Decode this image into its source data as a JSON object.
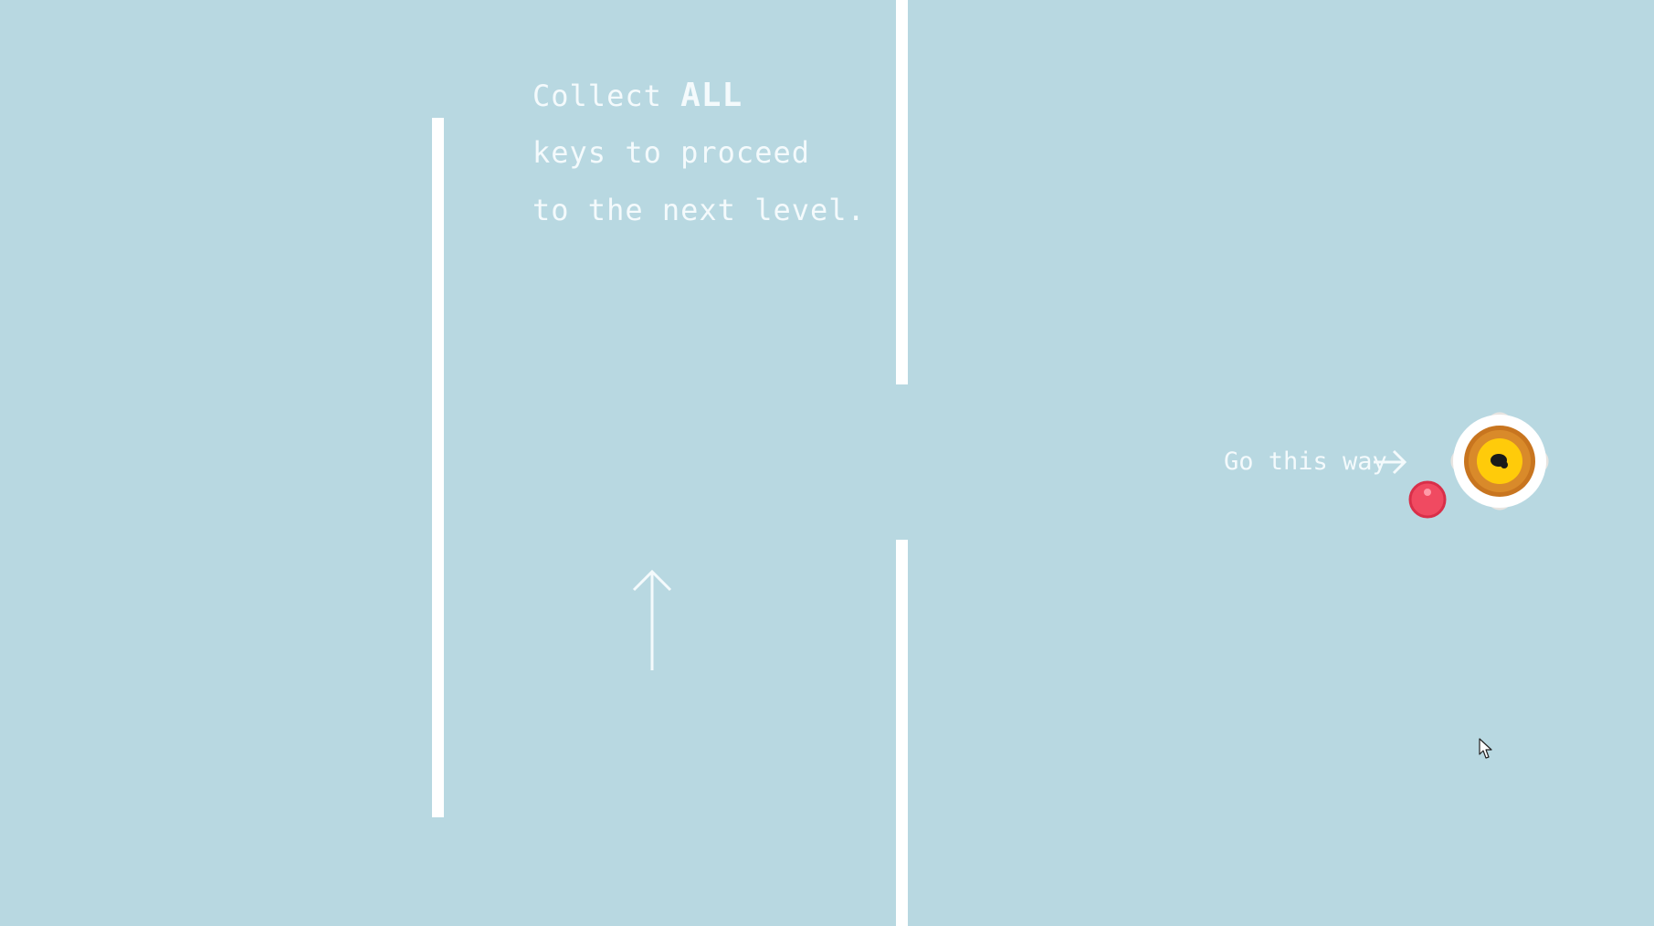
{
  "instructions": {
    "line1_prefix": "Collect ",
    "line1_emphasis": "ALL",
    "line2": "keys to proceed",
    "line3": "to the next level."
  },
  "direction_hint": {
    "label": "Go this way",
    "arrow_icon": "right-arrow-icon"
  },
  "icons": {
    "up_arrow": "up-arrow-icon",
    "key_goal": "key-orb-icon",
    "player": "player-ball",
    "cursor": "mouse-pointer-icon"
  },
  "colors": {
    "background": "#b8d8e1",
    "wall": "#ffffff",
    "text": "#f4fafc",
    "player": "#f04a61",
    "key_outer": "#c8751f",
    "key_inner": "#ffcb0a",
    "key_center": "#1a1a1a"
  }
}
